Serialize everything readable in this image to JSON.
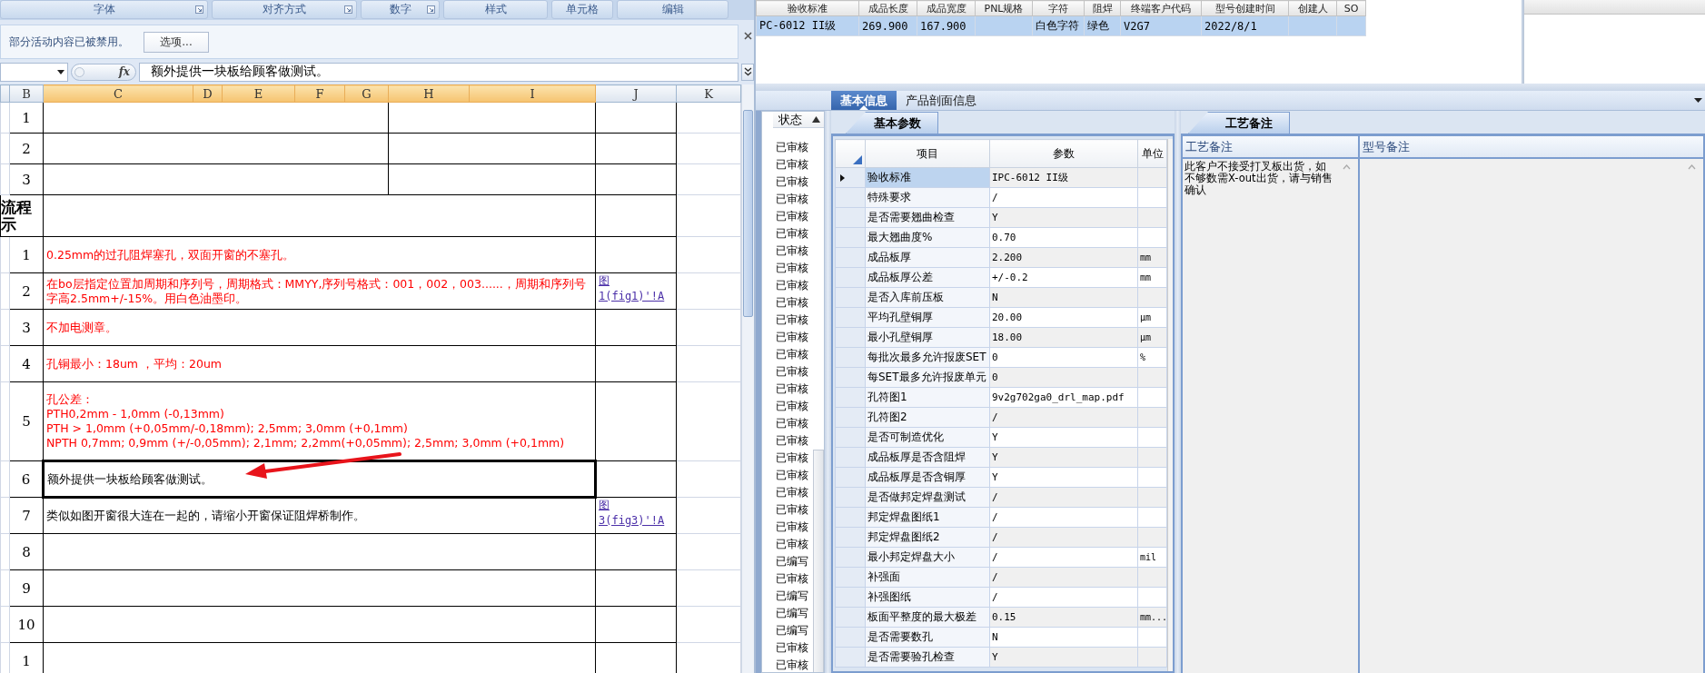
{
  "excel": {
    "ribbon_groups": [
      {
        "label": "字体",
        "launcher": true
      },
      {
        "label": "对齐方式",
        "launcher": true
      },
      {
        "label": "数字",
        "launcher": true
      },
      {
        "label": "样式",
        "launcher": false
      },
      {
        "label": "单元格",
        "launcher": false
      },
      {
        "label": "编辑",
        "launcher": false
      }
    ],
    "message_bar": {
      "text": "部分活动内容已被禁用。",
      "button": "选项..."
    },
    "formula_bar": {
      "function_button": "fx",
      "formula": "额外提供一块板给顾客做测试。"
    },
    "columns": [
      {
        "label": "B",
        "selected": false
      },
      {
        "label": "C",
        "selected": true
      },
      {
        "label": "D",
        "selected": true
      },
      {
        "label": "E",
        "selected": true
      },
      {
        "label": "F",
        "selected": true
      },
      {
        "label": "G",
        "selected": true
      },
      {
        "label": "H",
        "selected": true
      },
      {
        "label": "I",
        "selected": true
      },
      {
        "label": "J",
        "selected": false
      },
      {
        "label": "K",
        "selected": false
      }
    ],
    "rows": [
      {
        "kind": "split",
        "number": "1",
        "selected": false
      },
      {
        "kind": "split",
        "number": "2",
        "selected": false
      },
      {
        "kind": "split",
        "number": "3",
        "selected": false
      },
      {
        "kind": "heading",
        "label": "流程示",
        "selected": false
      },
      {
        "kind": "item",
        "number": "1",
        "text": "0.25mm的过孔阻焊塞孔，双面开窗的不塞孔。",
        "color": "#ff0000",
        "selected": false
      },
      {
        "kind": "item",
        "number": "2",
        "text": "在bo层指定位置加周期和序列号，周期格式：MMYY,序列号格式：001，002，003......，周期和序列号字高2.5mm+/-15%。用白色油墨印。",
        "color": "#ff0000",
        "link": "图\n1(fig1)'!A",
        "selected": false
      },
      {
        "kind": "item",
        "number": "3",
        "text": "不加电测章。",
        "color": "#ff0000",
        "selected": false
      },
      {
        "kind": "item",
        "number": "4",
        "text": "孔铜最小：18um ，平均：20um",
        "color": "#ff0000",
        "selected": false
      },
      {
        "kind": "item",
        "number": "5",
        "text": "孔公差：\nPTH0,2mm - 1,0mm (-0,13mm)\nPTH > 1,0mm (+0,05mm/-0,18mm); 2,5mm; 3,0mm (+0,1mm)\nNPTH 0,7mm; 0,9mm (+/-0,05mm); 2,1mm; 2,2mm(+0,05mm); 2,5mm; 3,0mm (+0,1mm)",
        "color": "#ff0000",
        "selected": false
      },
      {
        "kind": "item",
        "number": "6",
        "text": "额外提供一块板给顾客做测试。",
        "color": "#000000",
        "selected": true
      },
      {
        "kind": "item",
        "number": "7",
        "text": "类似如图开窗很大连在一起的，请缩小开窗保证阻焊桥制作。",
        "color": "#000000",
        "link": "图\n3(fig3)'!A",
        "selected": false
      },
      {
        "kind": "item",
        "number": "8",
        "selected": false
      },
      {
        "kind": "item",
        "number": "9",
        "selected": false
      },
      {
        "kind": "item",
        "number": "10",
        "selected": false
      },
      {
        "kind": "item",
        "number": "1",
        "selected": false
      }
    ]
  },
  "app": {
    "top_grid": {
      "columns": [
        "验收标准",
        "成品长度",
        "成品宽度",
        "PNL规格",
        "字符",
        "阻焊",
        "终端客户代码",
        "型号创建时间",
        "创建人",
        "SO"
      ],
      "rows": [
        {
          "selected": true,
          "cells": [
            "PC-6012 II级",
            "269.900",
            "167.900",
            null,
            "白色字符",
            "绿色",
            "V2G7",
            "2022/8/1"
          ]
        }
      ]
    },
    "detail_tabs": [
      {
        "label": "基本信息",
        "selected": true
      },
      {
        "label": "产品剖面信息",
        "selected": false
      }
    ],
    "status_list": {
      "header": "状态",
      "items": [
        "已审核",
        "已审核",
        "已审核",
        "已审核",
        "已审核",
        "已审核",
        "已审核",
        "已审核",
        "已审核",
        "已审核",
        "已审核",
        "已审核",
        "已审核",
        "已审核",
        "已审核",
        "已审核",
        "已审核",
        "已审核",
        "已审核",
        "已审核",
        "已审核",
        "已审核",
        "已审核",
        "已审核",
        "已编写",
        "已审核",
        "已编写",
        "已编写",
        "已编写",
        "已审核",
        "已审核"
      ]
    },
    "params": {
      "tab": "基本参数",
      "columns": [
        "项目",
        "参数",
        "单位"
      ],
      "rows": [
        {
          "item": "验收标准",
          "value": "IPC-6012 II级",
          "selected": true
        },
        {
          "item": "特殊要求",
          "value": "/",
          "selected": false
        },
        {
          "item": "是否需要翘曲检查",
          "value": "Y",
          "selected": false
        },
        {
          "item": "最大翘曲度%",
          "value": "0.70",
          "selected": false
        },
        {
          "item": "成品板厚",
          "value": "2.200",
          "unit": "mm",
          "selected": false
        },
        {
          "item": "成品板厚公差",
          "value": "+/-0.2",
          "unit": "mm",
          "selected": false
        },
        {
          "item": "是否入库前压板",
          "value": "N",
          "selected": false
        },
        {
          "item": "平均孔壁铜厚",
          "value": "20.00",
          "unit": "μm",
          "selected": false
        },
        {
          "item": "最小孔壁铜厚",
          "value": "18.00",
          "unit": "μm",
          "selected": false
        },
        {
          "item": "每批次最多允许报废SET",
          "value": "0",
          "unit": "%",
          "selected": false
        },
        {
          "item": "每SET最多允许报废单元",
          "value": "0",
          "selected": false
        },
        {
          "item": "孔符图1",
          "value": "9v2g702ga0_drl_map.pdf",
          "selected": false
        },
        {
          "item": "孔符图2",
          "value": "/",
          "selected": false
        },
        {
          "item": "是否可制造优化",
          "value": "Y",
          "selected": false
        },
        {
          "item": "成品板厚是否含阻焊",
          "value": "Y",
          "selected": false
        },
        {
          "item": "成品板厚是否含铜厚",
          "value": "Y",
          "selected": false
        },
        {
          "item": "是否做邦定焊盘测试",
          "value": "/",
          "selected": false
        },
        {
          "item": "邦定焊盘图纸1",
          "value": "/",
          "selected": false
        },
        {
          "item": "邦定焊盘图纸2",
          "value": "/",
          "selected": false
        },
        {
          "item": "最小邦定焊盘大小",
          "value": "/",
          "unit": "mil",
          "selected": false
        },
        {
          "item": "补强面",
          "value": "/",
          "selected": false
        },
        {
          "item": "补强图纸",
          "value": "/",
          "selected": false
        },
        {
          "item": "板面平整度的最大极差",
          "value": "0.15",
          "unit": "mm...",
          "selected": false
        },
        {
          "item": "是否需要数孔",
          "value": "N",
          "selected": false
        },
        {
          "item": "是否需要验孔检查",
          "value": "Y",
          "selected": false
        }
      ]
    },
    "notes": {
      "tab": "工艺备注",
      "columns": [
        "工艺备注",
        "型号备注"
      ],
      "process_note": "此客户不接受打叉板出货，如不够数需X-out出货，请与销售确认"
    }
  }
}
